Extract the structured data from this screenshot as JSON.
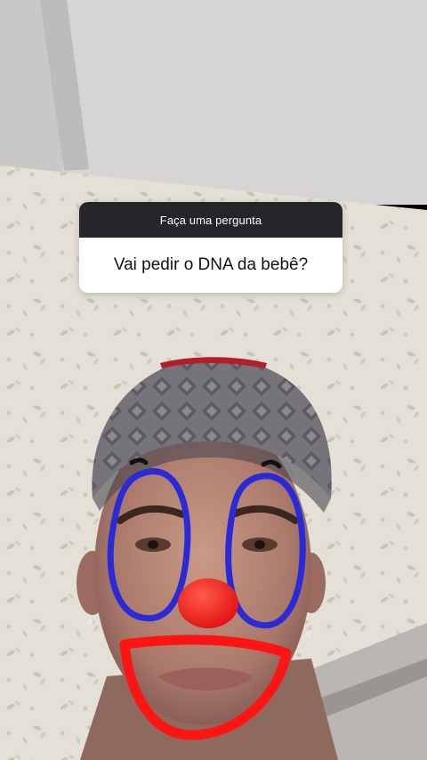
{
  "story": {
    "question_sticker": {
      "header": "Faça uma pergunta",
      "question": "Vai pedir o DNA da bebê?"
    }
  },
  "colors": {
    "sticker_header_bg": "#26262a",
    "sticker_body_bg": "#ffffff",
    "clown_blue": "#2a2bd6",
    "clown_red": "#ff1414"
  }
}
